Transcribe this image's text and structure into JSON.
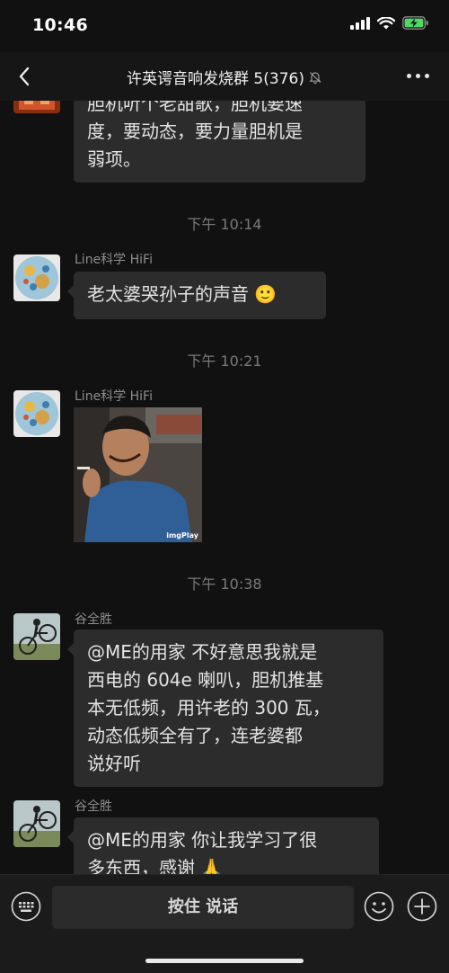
{
  "status_bar": {
    "time": "10:46",
    "icons": [
      "signal-icon",
      "wifi-icon",
      "battery-charging-icon"
    ]
  },
  "nav": {
    "back_icon": "chevron-left-icon",
    "title": "许英谔音响发烧群 5(376)",
    "mute_icon": "bell-muted-icon",
    "more_icon": "more-dots-icon"
  },
  "messages": [
    {
      "type": "text",
      "text_lines": [
        "胆机听个老甜歌，胆机要速",
        "度，要动态，要力量胆机是",
        "弱项。"
      ]
    },
    {
      "type": "timestamp",
      "text": "下午 10:14"
    },
    {
      "type": "text",
      "sender": "Line科学 HiFi",
      "text": "老太婆哭孙子的声音",
      "emoji": "🙂"
    },
    {
      "type": "timestamp",
      "text": "下午 10:21"
    },
    {
      "type": "image",
      "sender": "Line科学 HiFi",
      "watermark": "imgPlay"
    },
    {
      "type": "timestamp",
      "text": "下午 10:38"
    },
    {
      "type": "text",
      "sender": "谷全胜",
      "text_lines": [
        "@ME的用家 不好意思我就是",
        "西电的 604e 喇叭，胆机推基",
        "本无低频，用许老的 300 瓦，",
        "动态低频全有了，连老婆都",
        "说好听"
      ]
    },
    {
      "type": "text",
      "sender": "谷全胜",
      "text_lines": [
        "@ME的用家 你让我学习了很",
        "多东西，感谢"
      ],
      "emoji": "🙏"
    }
  ],
  "input_bar": {
    "voice_icon": "keyboard-icon",
    "hold_to_talk": "按住 说话",
    "emoji_icon": "smiley-icon",
    "plus_icon": "plus-circle-icon"
  },
  "colors": {
    "background": "#111111",
    "bubble": "#2c2c2c",
    "text": "#e4e4e4",
    "meta": "#7a7a7a",
    "battery": "#4cd964"
  }
}
